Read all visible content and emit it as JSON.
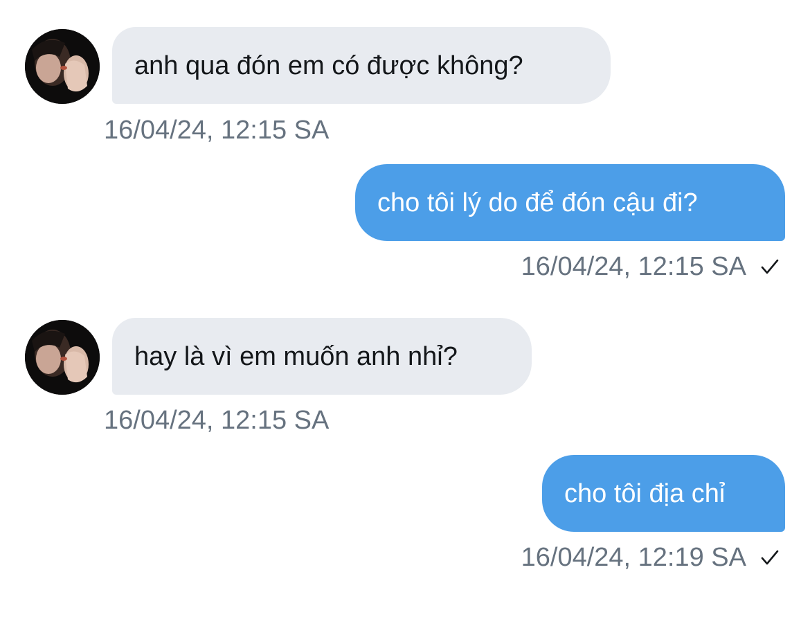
{
  "messages": [
    {
      "direction": "incoming",
      "text": "anh qua đón em có được không?",
      "time": "16/04/24, 12:15 SA"
    },
    {
      "direction": "outgoing",
      "text": "cho tôi lý do để đón cậu đi?",
      "time": "16/04/24, 12:15 SA",
      "status_icon": "check-icon"
    },
    {
      "direction": "incoming",
      "text": "hay là vì em muốn anh nhỉ?",
      "time": "16/04/24, 12:15 SA"
    },
    {
      "direction": "outgoing",
      "text": "cho tôi địa chỉ",
      "time": "16/04/24, 12:19 SA",
      "status_icon": "check-icon"
    }
  ],
  "colors": {
    "incoming_bubble": "#e8ebf0",
    "outgoing_bubble": "#4c9ee8",
    "timestamp": "#66727f",
    "background": "#ffffff"
  }
}
